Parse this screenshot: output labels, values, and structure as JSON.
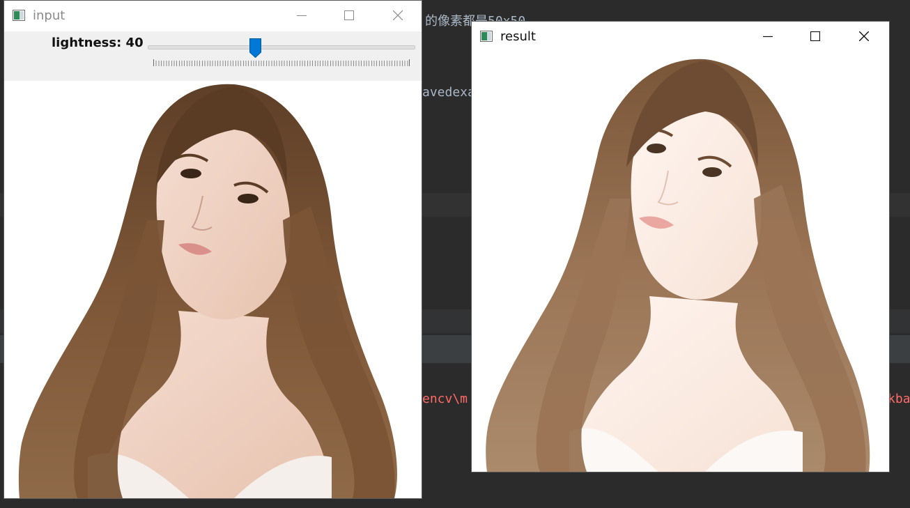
{
  "background_editor": {
    "fragments": [
      {
        "text": "的像素都是50x50",
        "color": "#a9b7c6"
      },
      {
        "text": "avedexa",
        "color": "#a9b7c6"
      },
      {
        "text": "encv\\m",
        "color": "#ff6b68"
      },
      {
        "text": "kba",
        "color": "#ff6b68"
      }
    ]
  },
  "input_window": {
    "title": "input",
    "minimize_icon": "minimize-icon",
    "maximize_icon": "maximize-icon",
    "close_icon": "close-icon",
    "trackbar": {
      "label": "lightness: 40",
      "value": 40,
      "max": 100
    },
    "image_subject": "portrait-photo"
  },
  "result_window": {
    "title": "result",
    "minimize_icon": "minimize-icon",
    "maximize_icon": "maximize-icon",
    "close_icon": "close-icon",
    "image_subject": "portrait-photo-brightened"
  },
  "colors": {
    "accent_thumb": "#0078d7",
    "hair": "#7a5436",
    "skin": "#f1d6c8",
    "dress": "#f4efeb"
  }
}
